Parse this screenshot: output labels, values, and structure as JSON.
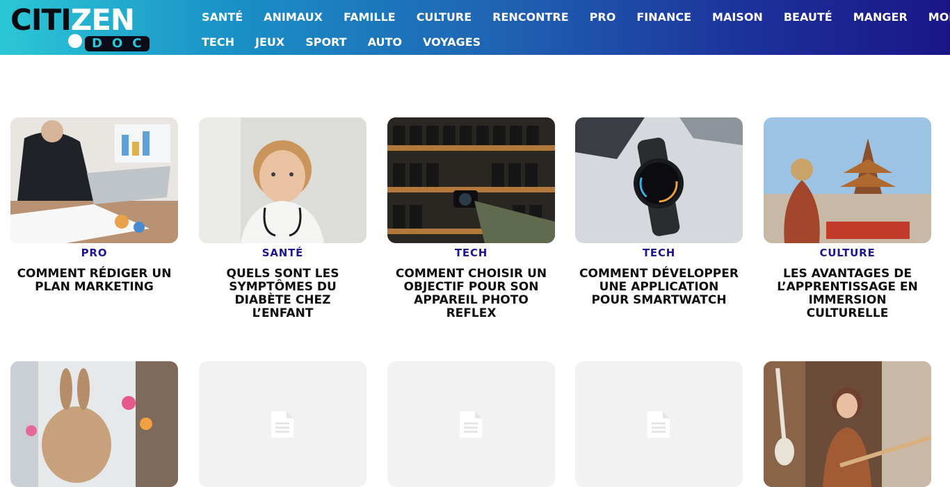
{
  "brand": {
    "logo_top_left": "CITI",
    "logo_top_right": "ZEN",
    "logo_bottom": "DOC"
  },
  "nav": {
    "row1": [
      "SANTÉ",
      "ANIMAUX",
      "FAMILLE",
      "CULTURE",
      "RENCONTRE",
      "PRO",
      "FINANCE",
      "MAISON",
      "BEAUTÉ",
      "MANGER",
      "MODE"
    ],
    "row2": [
      "TECH",
      "JEUX",
      "SPORT",
      "AUTO",
      "VOYAGES"
    ]
  },
  "articles": [
    {
      "category": "PRO",
      "title": "COMMENT RÉDIGER UN PLAN MARKETING",
      "image": "businesswoman-laptop-photo"
    },
    {
      "category": "SANTÉ",
      "title": "QUELS SONT LES SYMPTÔMES DU DIABÈTE CHEZ L’ENFANT",
      "image": "child-doctor-coat-photo"
    },
    {
      "category": "TECH",
      "title": "COMMENT CHOISIR UN OBJECTIF POUR SON APPAREIL PHOTO REFLEX",
      "image": "camera-lens-shelf-photo"
    },
    {
      "category": "TECH",
      "title": "COMMENT DÉVELOPPER UNE APPLICATION POUR SMARTWATCH",
      "image": "smartwatch-photo"
    },
    {
      "category": "CULTURE",
      "title": "LES AVANTAGES DE L’APPRENTISSAGE EN IMMERSION CULTURELLE",
      "image": "temple-market-photo"
    }
  ],
  "second_row_images": [
    "rabbit-garden-photo",
    "document-placeholder-icon",
    "document-placeholder-icon",
    "document-placeholder-icon",
    "guitarist-music-shop-photo"
  ],
  "colors": {
    "header_gradient_start": "#2bc7d6",
    "header_gradient_end": "#1a1688",
    "category_text": "#1d1690",
    "title_text": "#0d0d0d"
  }
}
